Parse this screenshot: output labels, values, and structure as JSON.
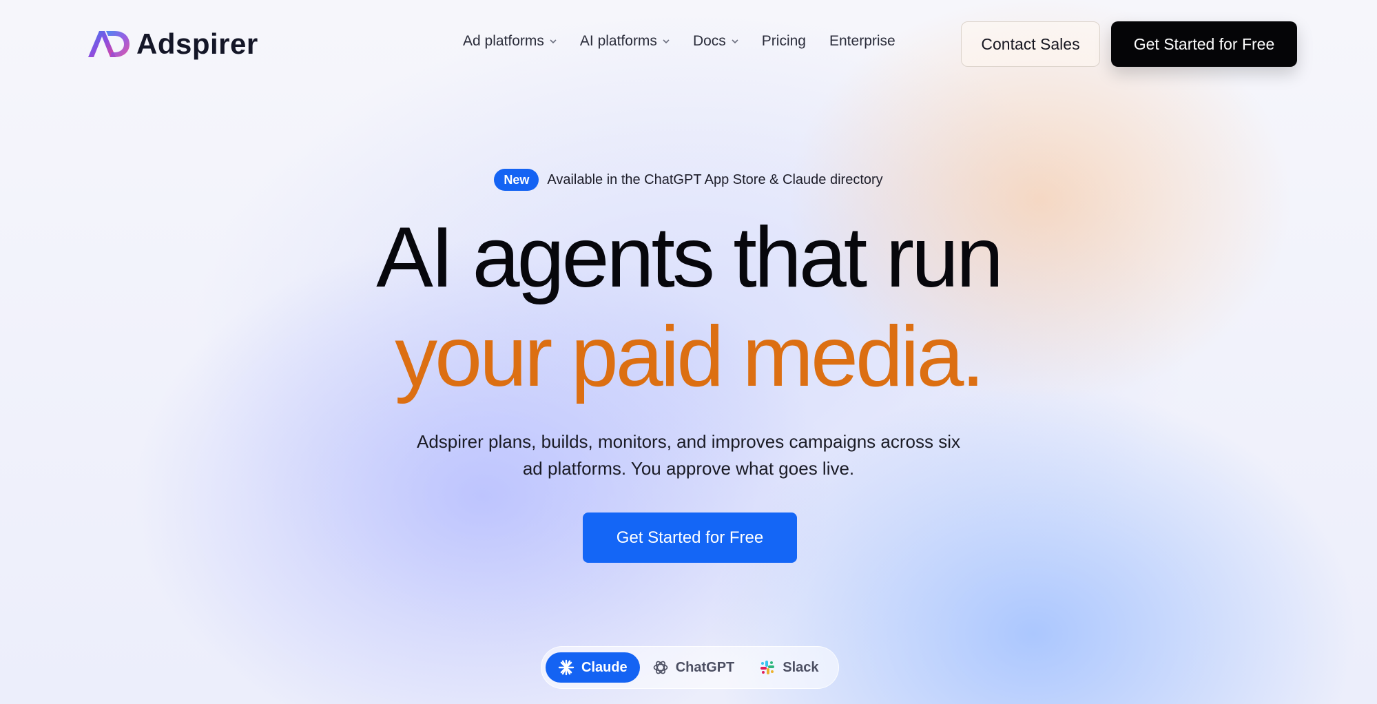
{
  "brand": {
    "name": "Adspirer"
  },
  "nav": {
    "items": [
      {
        "label": "Ad platforms",
        "has_dropdown": true
      },
      {
        "label": "AI platforms",
        "has_dropdown": true
      },
      {
        "label": "Docs",
        "has_dropdown": true
      },
      {
        "label": "Pricing",
        "has_dropdown": false
      },
      {
        "label": "Enterprise",
        "has_dropdown": false
      }
    ],
    "contact_label": "Contact Sales",
    "cta_label": "Get Started for Free"
  },
  "hero": {
    "badge": "New",
    "announcement": "Available in the ChatGPT App Store & Claude directory",
    "headline_line1": "AI agents that run",
    "headline_line2": "your paid media.",
    "subtitle_line1": "Adspirer plans, builds, monitors, and improves campaigns across six",
    "subtitle_line2": "ad platforms. You approve what goes live.",
    "cta_label": "Get Started for Free"
  },
  "switcher": {
    "items": [
      {
        "label": "Claude",
        "icon": "claude-icon",
        "active": true
      },
      {
        "label": "ChatGPT",
        "icon": "chatgpt-icon",
        "active": false
      },
      {
        "label": "Slack",
        "icon": "slack-icon",
        "active": false
      }
    ]
  },
  "colors": {
    "accent_blue": "#1463f3",
    "headline_orange": "#dc6f12",
    "dark_button": "#050507"
  }
}
